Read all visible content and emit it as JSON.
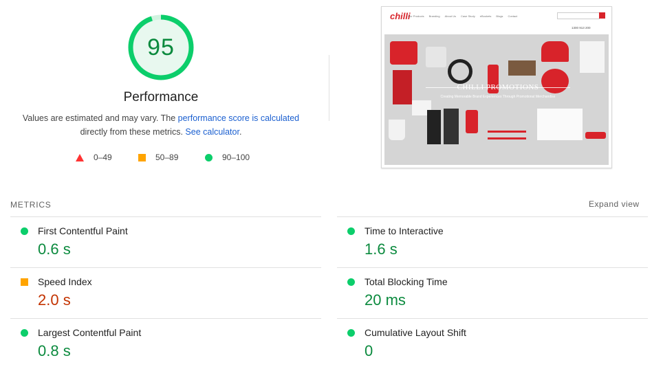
{
  "performance": {
    "score": "95",
    "score_fraction": 0.95,
    "title": "Performance",
    "desc_prefix": "Values are estimated and may vary. The ",
    "desc_link": "performance score is calculated",
    "desc_middle": " directly from these metrics. ",
    "desc_calc_link": "See calculator",
    "desc_suffix": ".",
    "colors": {
      "pass": "#0cce6b",
      "average": "#ffa400",
      "fail": "#ff3333"
    }
  },
  "legend": [
    {
      "icon": "triangle-icon",
      "range": "0–49"
    },
    {
      "icon": "square-icon",
      "range": "50–89"
    },
    {
      "icon": "circle-icon",
      "range": "90–100"
    }
  ],
  "screenshot": {
    "logo": "chilli",
    "menu": [
      "Our Products",
      "Branding",
      "About Us",
      "Case Study",
      "eBookets",
      "Blogs",
      "Contact"
    ],
    "phone": "1300 913 200",
    "banner_title": "CHILLI PROMOTIONS",
    "banner_subtitle": "Creating Memorable Brand Experiences Through Promotional Merchandise"
  },
  "metrics": {
    "heading": "METRICS",
    "expand": "Expand view",
    "items": [
      {
        "label": "First Contentful Paint",
        "value": "0.6 s",
        "status": "pass"
      },
      {
        "label": "Time to Interactive",
        "value": "1.6 s",
        "status": "pass"
      },
      {
        "label": "Speed Index",
        "value": "2.0 s",
        "status": "average"
      },
      {
        "label": "Total Blocking Time",
        "value": "20 ms",
        "status": "pass"
      },
      {
        "label": "Largest Contentful Paint",
        "value": "0.8 s",
        "status": "pass"
      },
      {
        "label": "Cumulative Layout Shift",
        "value": "0",
        "status": "pass"
      }
    ]
  }
}
